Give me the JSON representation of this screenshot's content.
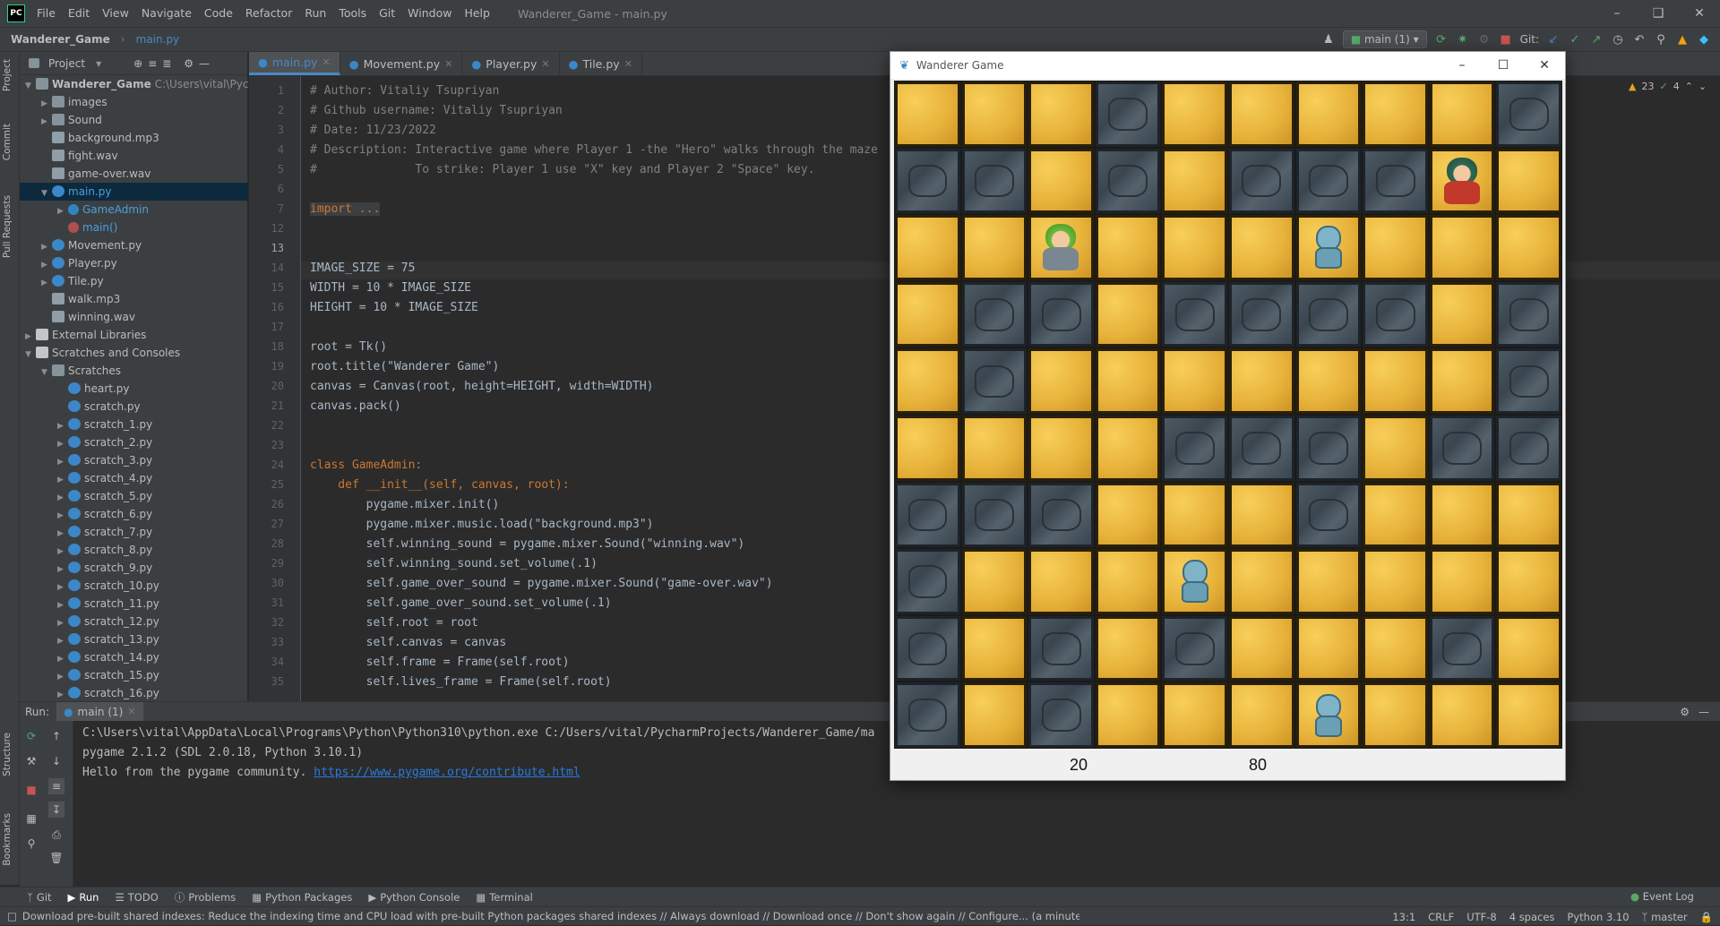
{
  "ide": {
    "menu": [
      "File",
      "Edit",
      "View",
      "Navigate",
      "Code",
      "Refactor",
      "Run",
      "Tools",
      "Git",
      "Window",
      "Help"
    ],
    "window_title": "Wanderer_Game - main.py",
    "logo_text": "PC",
    "breadcrumb": {
      "project": "Wanderer_Game",
      "file": "main.py"
    },
    "branch": "main (1)",
    "git_label": "Git:",
    "project_panel": {
      "title": "Project",
      "root": "Wanderer_Game",
      "root_path": "C:\\Users\\vital\\Pychar",
      "items": [
        "images",
        "Sound",
        "background.mp3",
        "fight.wav",
        "game-over.wav",
        "main.py",
        "GameAdmin",
        "main()",
        "Movement.py",
        "Player.py",
        "Tile.py",
        "walk.mp3",
        "winning.wav",
        "External Libraries",
        "Scratches and Consoles",
        "Scratches",
        "heart.py",
        "scratch.py",
        "scratch_1.py",
        "scratch_2.py",
        "scratch_3.py",
        "scratch_4.py",
        "scratch_5.py",
        "scratch_6.py",
        "scratch_7.py",
        "scratch_8.py",
        "scratch_9.py",
        "scratch_10.py",
        "scratch_11.py",
        "scratch_12.py",
        "scratch_13.py",
        "scratch_14.py",
        "scratch_15.py",
        "scratch_16.py"
      ]
    },
    "left_strip": {
      "project": "Project",
      "commit": "Commit",
      "pull_requests": "Pull Requests",
      "structure": "Structure",
      "bookmarks": "Bookmarks"
    },
    "tabs": [
      "main.py",
      "Movement.py",
      "Player.py",
      "Tile.py"
    ],
    "inspections": {
      "warnings": "23",
      "weak": "4"
    },
    "line_numbers": [
      "1",
      "2",
      "3",
      "4",
      "5",
      "6",
      "7",
      "12",
      "13",
      "14",
      "15",
      "16",
      "17",
      "18",
      "19",
      "20",
      "21",
      "22",
      "23",
      "24",
      "25",
      "26",
      "27",
      "28",
      "29",
      "30",
      "31",
      "32",
      "33",
      "34",
      "35"
    ],
    "code": {
      "l1": "# Author: Vitaliy Tsupriyan",
      "l2": "# Github username: Vitaliy Tsupriyan",
      "l3": "# Date: 11/23/2022",
      "l4": "# Description: Interactive game where Player 1 -the \"Hero\" walks through the maze",
      "l5": "#              To strike: Player 1 use \"X\" key and Player 2 \"Space\" key.",
      "l7": "import ...",
      "l14": "IMAGE_SIZE = 75",
      "l15": "WIDTH = 10 * IMAGE_SIZE",
      "l16": "HEIGHT = 10 * IMAGE_SIZE",
      "l18": "root = Tk()",
      "l19": "root.title(\"Wanderer Game\")",
      "l20": "canvas = Canvas(root, height=HEIGHT, width=WIDTH)",
      "l21": "canvas.pack()",
      "l24": "class GameAdmin:",
      "l25": "    def __init__(self, canvas, root):",
      "l26": "        pygame.mixer.init()",
      "l27": "        pygame.mixer.music.load(\"background.mp3\")",
      "l28": "        self.winning_sound = pygame.mixer.Sound(\"winning.wav\")",
      "l29": "        self.winning_sound.set_volume(.1)",
      "l30": "        self.game_over_sound = pygame.mixer.Sound(\"game-over.wav\")",
      "l31": "        self.game_over_sound.set_volume(.1)",
      "l32": "        self.root = root",
      "l33": "        self.canvas = canvas",
      "l34": "        self.frame = Frame(self.root)",
      "l35": "        self.lives_frame = Frame(self.root)"
    },
    "run": {
      "label": "Run:",
      "tab": "main (1)",
      "output": [
        "C:\\Users\\vital\\AppData\\Local\\Programs\\Python\\Python310\\python.exe C:/Users/vital/PycharmProjects/Wanderer_Game/ma",
        "pygame 2.1.2 (SDL 2.0.18, Python 3.10.1)",
        "Hello from the pygame community. "
      ],
      "link": "https://www.pygame.org/contribute.html"
    },
    "bottom_tabs": [
      "Git",
      "Run",
      "TODO",
      "Problems",
      "Python Packages",
      "Python Console",
      "Terminal"
    ],
    "event_log": "Event Log",
    "status": {
      "message": "Download pre-built shared indexes: Reduce the indexing time and CPU load with pre-built Python packages shared indexes // Always download // Download once // Don't show again // Configure... (a minute ago)",
      "position": "13:1",
      "line_sep": "CRLF",
      "encoding": "UTF-8",
      "indent": "4 spaces",
      "interpreter": "Python 3.10",
      "branch": "master"
    }
  },
  "game": {
    "title": "Wanderer Game",
    "board": [
      "FFFWFFFFFW",
      "WWFWFWWWFF",
      "FFFFFFFFFF",
      "FWWFWWWWFW",
      "FWFFFFFFFW",
      "FFFFWWWFWW",
      "WWWFFFWFFF",
      "WFFFFFFFFF",
      "WFWFWFFFWF",
      "WFWFFFFFFF"
    ],
    "sprites": [
      {
        "type": "hero",
        "row": 2,
        "col": 2
      },
      {
        "type": "boss",
        "row": 1,
        "col": 8
      },
      {
        "type": "skeleton",
        "row": 2,
        "col": 6
      },
      {
        "type": "skeleton",
        "row": 7,
        "col": 4
      },
      {
        "type": "skeleton",
        "row": 9,
        "col": 6
      }
    ],
    "score_left": "20",
    "score_right": "80"
  }
}
